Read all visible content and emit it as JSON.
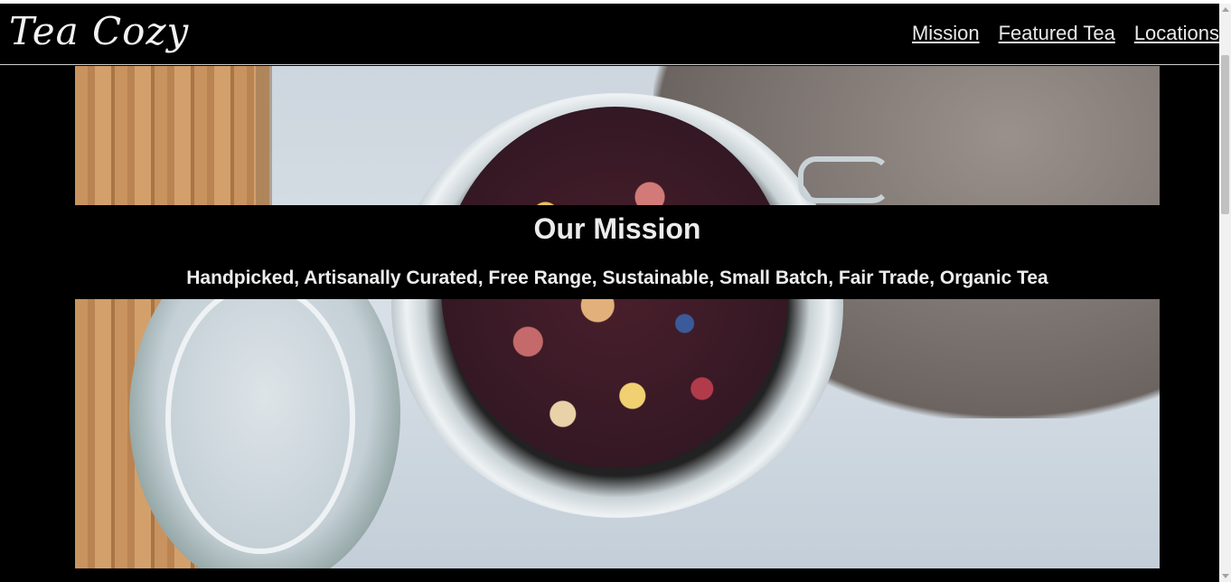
{
  "header": {
    "logo_text": "Tea Cozy",
    "nav": [
      {
        "label": "Mission"
      },
      {
        "label": "Featured Tea"
      },
      {
        "label": "Locations"
      }
    ]
  },
  "hero": {
    "image_subject": "glass jar of loose-leaf herbal tea on a table"
  },
  "mission": {
    "heading": "Our Mission",
    "tagline": "Handpicked, Artisanally Curated, Free Range, Sustainable, Small Batch, Fair Trade, Organic Tea"
  },
  "colors": {
    "background": "#000000",
    "text": "#ececec"
  }
}
